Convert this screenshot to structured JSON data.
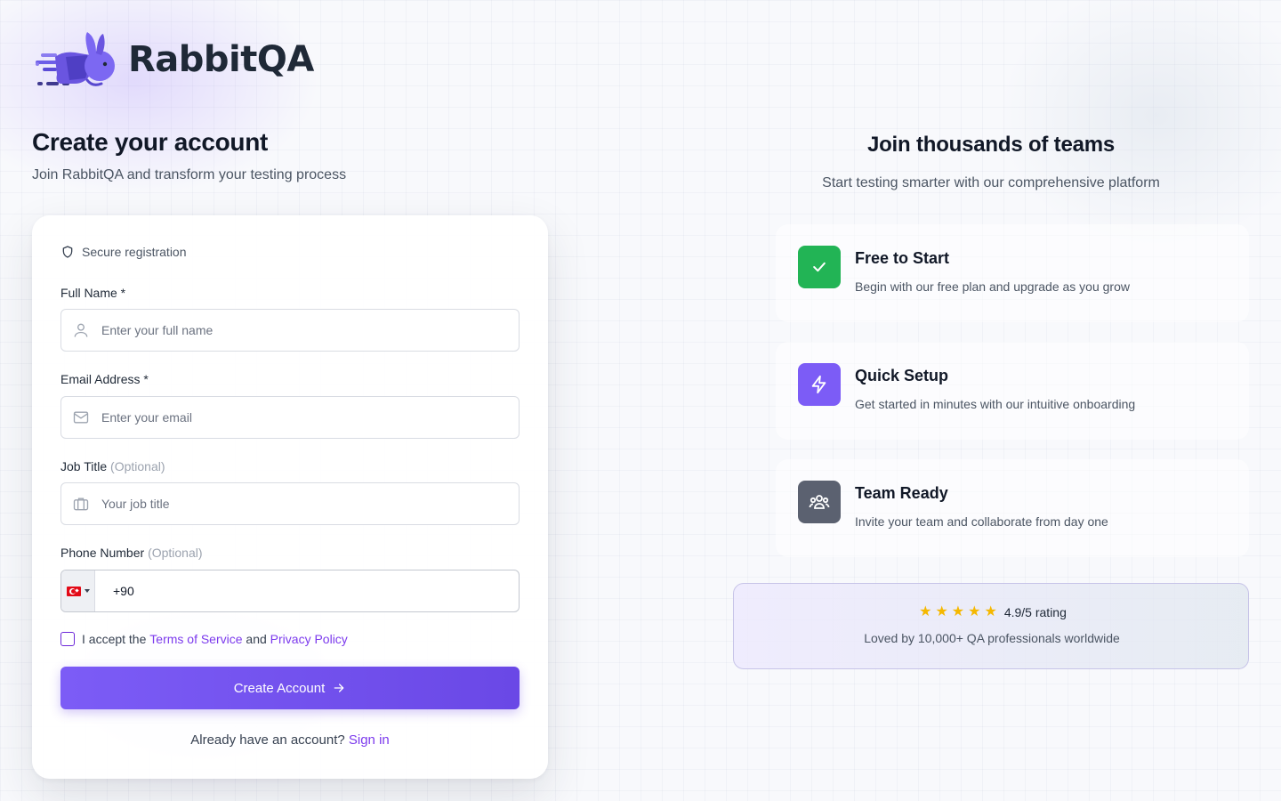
{
  "brand": {
    "name": "RabbitQA",
    "accent": "#6d4ae8"
  },
  "left": {
    "title": "Create your account",
    "subtitle": "Join RabbitQA and transform your testing process"
  },
  "form": {
    "secure_label": "Secure registration",
    "full_name": {
      "label": "Full Name *",
      "placeholder": "Enter your full name",
      "icon": "user-icon"
    },
    "email": {
      "label": "Email Address *",
      "placeholder": "Enter your email",
      "icon": "mail-icon"
    },
    "job_title": {
      "label": "Job Title",
      "optional": "(Optional)",
      "placeholder": "Your job title",
      "icon": "briefcase-icon"
    },
    "phone": {
      "label": "Phone Number",
      "optional": "(Optional)",
      "country": "TR",
      "value": "+90",
      "icon": "turkey-flag-icon"
    },
    "terms": {
      "prefix": "I accept the",
      "terms_link": "Terms of Service",
      "and": "and",
      "privacy_link": "Privacy Policy"
    },
    "submit_label": "Create Account",
    "signin_prompt": "Already have an account?",
    "signin_link": "Sign in"
  },
  "right": {
    "title": "Join thousands of teams",
    "subtitle": "Start testing smarter with our comprehensive platform",
    "features": [
      {
        "title": "Free to Start",
        "desc": "Begin with our free plan and upgrade as you grow",
        "icon": "check-icon",
        "color": "#22b455"
      },
      {
        "title": "Quick Setup",
        "desc": "Get started in minutes with our intuitive onboarding",
        "icon": "lightning-icon",
        "color": "#7c5cf6"
      },
      {
        "title": "Team Ready",
        "desc": "Invite your team and collaborate from day one",
        "icon": "team-icon",
        "color": "#5b6170"
      }
    ],
    "rating": {
      "stars": 5,
      "value": "4.9/5 rating",
      "subtitle": "Loved by 10,000+ QA professionals worldwide"
    }
  }
}
